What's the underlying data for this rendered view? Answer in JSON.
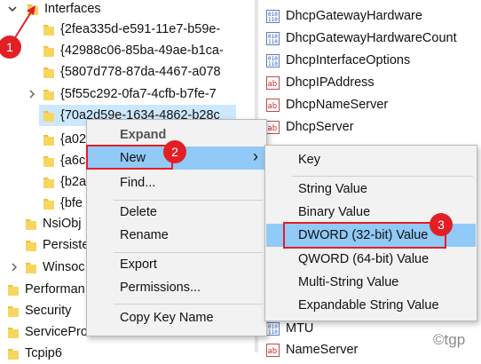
{
  "tree": {
    "interfaces": "Interfaces",
    "guids": [
      "{2fea335d-e591-11e7-b59e-",
      "{42988c06-85ba-49ae-b1ca-",
      "{5807d778-87da-4467-a078",
      "{5f55c292-0fa7-4cfb-b7fe-7",
      "{70a2d59e-1634-4862-b28c",
      "{a02",
      "{a6c",
      "{b2a",
      "{bfe"
    ],
    "nsiobj": "NsiObj",
    "persiste": "Persiste",
    "winsoc": "Winsoc",
    "performan": "Performan",
    "security": "Security",
    "serviceprovider": "ServiceProvider",
    "bottom_partial": "Tcpip6"
  },
  "values": [
    "DhcpGatewayHardware",
    "DhcpGatewayHardwareCount",
    "DhcpInterfaceOptions",
    "DhcpIPAddress",
    "DhcpNameServer",
    "DhcpServer"
  ],
  "values_bottom": [
    "MTU",
    "NameServer"
  ],
  "context_menu": {
    "items": [
      {
        "label": "Expand",
        "bold": true
      },
      {
        "label": "New"
      },
      {
        "label": "Find..."
      },
      {
        "label": "Delete"
      },
      {
        "label": "Rename"
      },
      {
        "label": "Export"
      },
      {
        "label": "Permissions..."
      },
      {
        "label": "Copy Key Name"
      }
    ],
    "submenu_arrow": "›"
  },
  "submenu": {
    "items": [
      "Key",
      "String Value",
      "Binary Value",
      "DWORD (32-bit) Value",
      "QWORD (64-bit) Value",
      "Multi-String Value",
      "Expandable String Value"
    ]
  },
  "badges": [
    "1",
    "2",
    "3"
  ],
  "watermark": "©tgp",
  "colors": {
    "highlight": "#cce8ff",
    "menu_highlight": "#91c9f7",
    "annotation_red": "#e31f26",
    "folder": "#f0c23a"
  }
}
